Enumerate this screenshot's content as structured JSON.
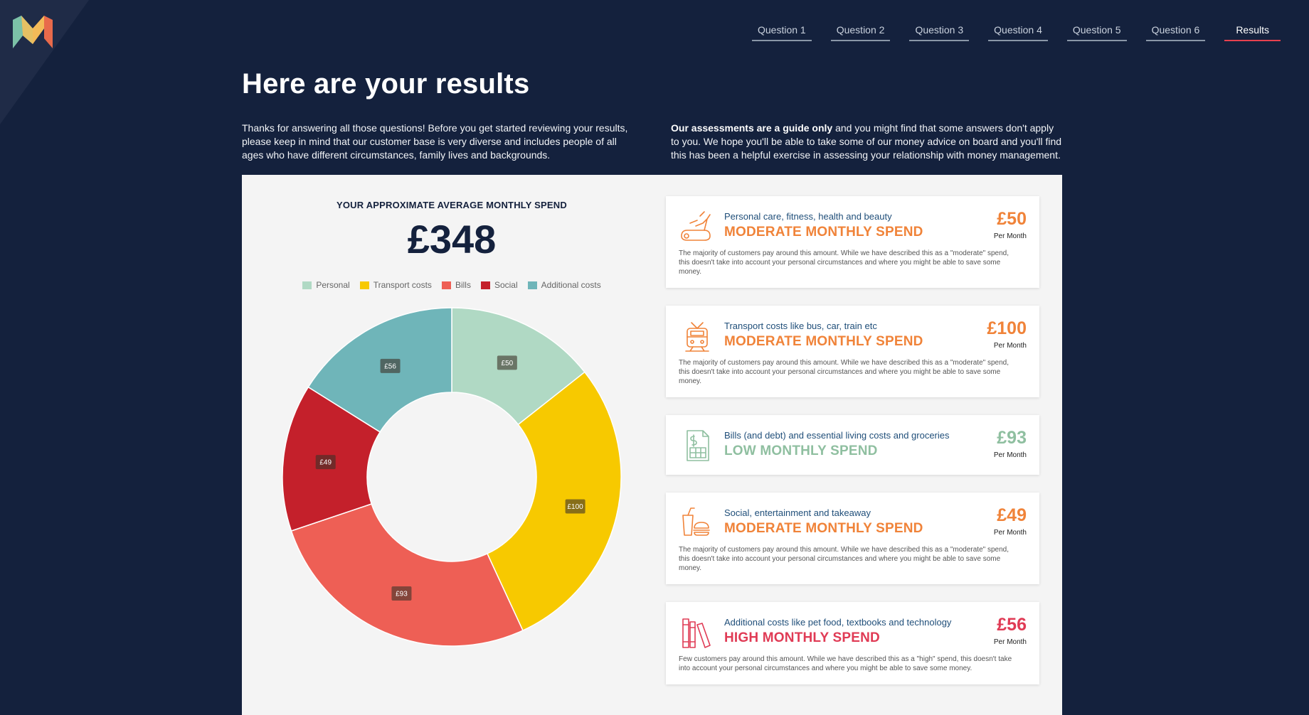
{
  "nav": {
    "items": [
      "Question 1",
      "Question 2",
      "Question 3",
      "Question 4",
      "Question 5",
      "Question 6",
      "Results"
    ],
    "active": "Results"
  },
  "page": {
    "title": "Here are your results",
    "intro_left": "Thanks for answering all those questions! Before you get started reviewing your results, please keep in mind that our customer base is very diverse and includes people of all ages who have different circumstances, family lives and backgrounds.",
    "intro_right_bold": "Our assessments are a guide only",
    "intro_right_rest": " and you might find that some answers don't apply to you. We hope you'll be able to take some of our money advice on board and you'll find this has been a helpful exercise in assessing your relationship with money management."
  },
  "summary": {
    "title": "YOUR APPROXIMATE AVERAGE MONTHLY SPEND",
    "amount": "£348"
  },
  "chart_data": {
    "type": "pie",
    "donut": true,
    "legend_position": "top",
    "categories": [
      "Personal",
      "Transport costs",
      "Bills",
      "Social",
      "Additional costs"
    ],
    "values": [
      50,
      100,
      93,
      49,
      56
    ],
    "labels": [
      "£50",
      "£100",
      "£93",
      "£49",
      "£56"
    ],
    "colors": [
      "#b0d9c4",
      "#f7c900",
      "#ee5f55",
      "#c4202b",
      "#6fb5b9"
    ]
  },
  "cards": [
    {
      "icon": "treadmill-icon",
      "category": "Personal care, fitness, health and beauty",
      "level": "MODERATE MONTHLY SPEND",
      "amount": "£50",
      "per": "Per Month",
      "color": "#f08339",
      "description": "The majority of customers pay around this amount. While we have described this as a \"moderate\" spend, this doesn't take into account your personal circumstances and where you might be able to save some money."
    },
    {
      "icon": "tram-icon",
      "category": "Transport costs like bus, car, train etc",
      "level": "MODERATE MONTHLY SPEND",
      "amount": "£100",
      "per": "Per Month",
      "color": "#f08339",
      "description": "The majority of customers pay around this amount. While we have described this as a \"moderate\" spend, this doesn't take into account your personal circumstances and where you might be able to save some money."
    },
    {
      "icon": "bill-icon",
      "category": "Bills (and debt) and essential living costs and groceries",
      "level": "LOW MONTHLY SPEND",
      "amount": "£93",
      "per": "Per Month",
      "color": "#8fbfa0",
      "description": ""
    },
    {
      "icon": "takeaway-icon",
      "category": "Social, entertainment and takeaway",
      "level": "MODERATE MONTHLY SPEND",
      "amount": "£49",
      "per": "Per Month",
      "color": "#f08339",
      "description": "The majority of customers pay around this amount. While we have described this as a \"moderate\" spend, this doesn't take into account your personal circumstances and where you might be able to save some money."
    },
    {
      "icon": "books-icon",
      "category": "Additional costs like pet food, textbooks and technology",
      "level": "HIGH MONTHLY SPEND",
      "amount": "£56",
      "per": "Per Month",
      "color": "#e03b55",
      "description": "Few customers pay around this amount. While we have described this as a \"high\" spend, this doesn't take into account your personal circumstances and where you might be able to save some money."
    }
  ]
}
